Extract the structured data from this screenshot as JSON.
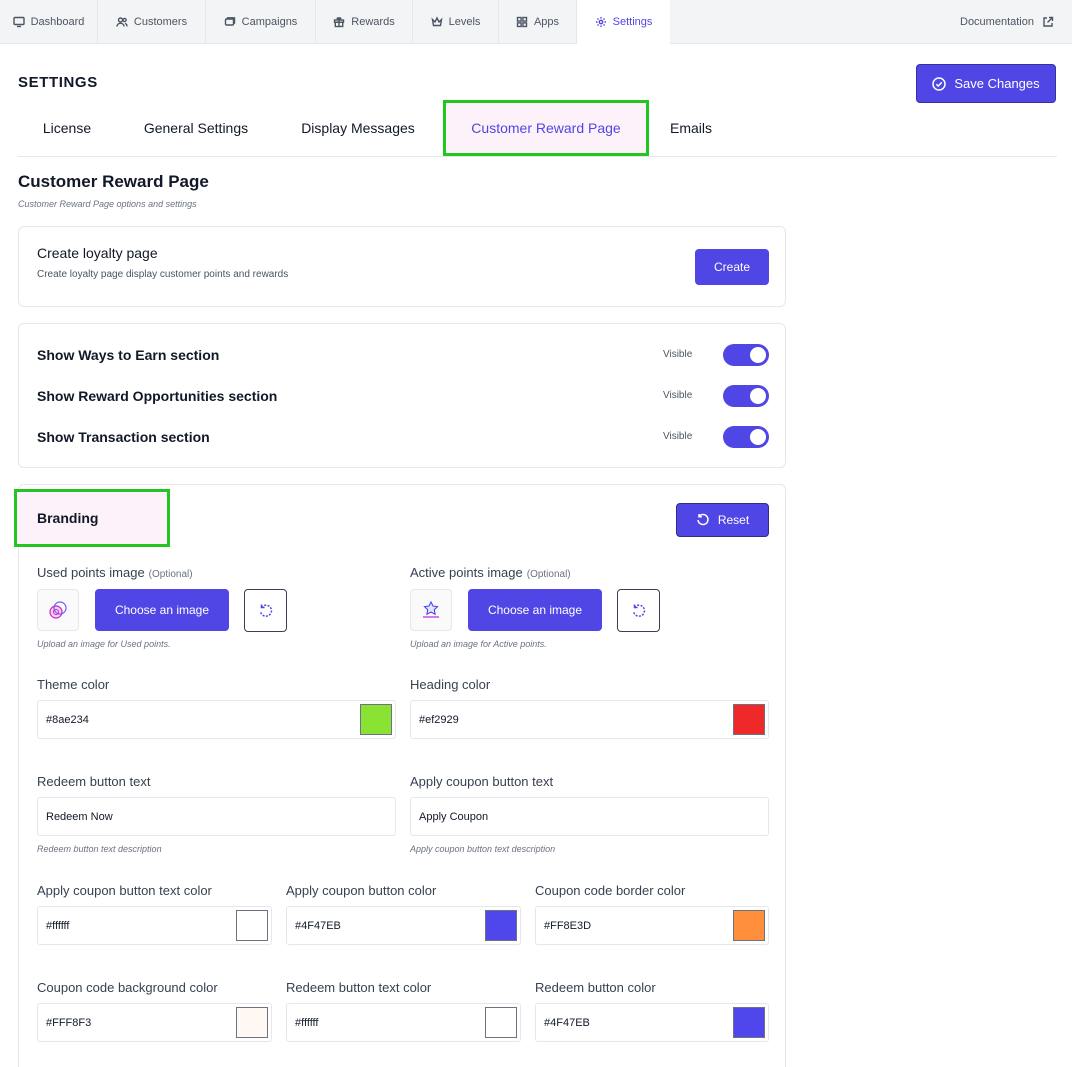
{
  "nav": {
    "tabs": [
      {
        "label": "Dashboard",
        "icon": "dashboard-icon"
      },
      {
        "label": "Customers",
        "icon": "users-icon"
      },
      {
        "label": "Campaigns",
        "icon": "campaign-icon"
      },
      {
        "label": "Rewards",
        "icon": "gift-icon"
      },
      {
        "label": "Levels",
        "icon": "crown-icon"
      },
      {
        "label": "Apps",
        "icon": "grid-icon"
      },
      {
        "label": "Settings",
        "icon": "gear-icon",
        "active": true
      }
    ],
    "documentation": "Documentation"
  },
  "page": {
    "title": "SETTINGS",
    "save_label": "Save Changes"
  },
  "subtabs": [
    {
      "label": "License"
    },
    {
      "label": "General Settings"
    },
    {
      "label": "Display Messages"
    },
    {
      "label": "Customer Reward Page",
      "active": true
    },
    {
      "label": "Emails"
    }
  ],
  "section": {
    "title": "Customer Reward Page",
    "description": "Customer Reward Page options and settings"
  },
  "loyalty": {
    "title": "Create loyalty page",
    "description": "Create loyalty page display customer points and rewards",
    "button": "Create"
  },
  "toggles": [
    {
      "label": "Show Ways to Earn section",
      "status": "Visible",
      "on": true
    },
    {
      "label": "Show Reward Opportunities section",
      "status": "Visible",
      "on": true
    },
    {
      "label": "Show Transaction section",
      "status": "Visible",
      "on": true
    }
  ],
  "branding": {
    "title": "Branding",
    "reset_label": "Reset",
    "used_points": {
      "label": "Used points image",
      "optional": "(Optional)",
      "button": "Choose an image",
      "hint": "Upload an image for Used points."
    },
    "active_points": {
      "label": "Active points image",
      "optional": "(Optional)",
      "button": "Choose an image",
      "hint": "Upload an image for Active points."
    },
    "theme_color": {
      "label": "Theme color",
      "value": "#8ae234",
      "swatch": "#8ae234"
    },
    "heading_color": {
      "label": "Heading color",
      "value": "#ef2929",
      "swatch": "#ef2929"
    },
    "redeem_text": {
      "label": "Redeem button text",
      "value": "Redeem Now",
      "hint": "Redeem button text description"
    },
    "apply_text": {
      "label": "Apply coupon button text",
      "value": "Apply Coupon",
      "hint": "Apply coupon button text description"
    },
    "apply_text_color": {
      "label": "Apply coupon button text color",
      "value": "#ffffff",
      "swatch": "#ffffff"
    },
    "apply_btn_color": {
      "label": "Apply coupon button color",
      "value": "#4F47EB",
      "swatch": "#4F47EB"
    },
    "coupon_border_color": {
      "label": "Coupon code border color",
      "value": "#FF8E3D",
      "swatch": "#FF8E3D"
    },
    "coupon_bg_color": {
      "label": "Coupon code background color",
      "value": "#FFF8F3",
      "swatch": "#FFF8F3"
    },
    "redeem_text_color": {
      "label": "Redeem button text color",
      "value": "#ffffff",
      "swatch": "#ffffff"
    },
    "redeem_btn_color": {
      "label": "Redeem button color",
      "value": "#4F47EB",
      "swatch": "#4F47EB"
    }
  }
}
